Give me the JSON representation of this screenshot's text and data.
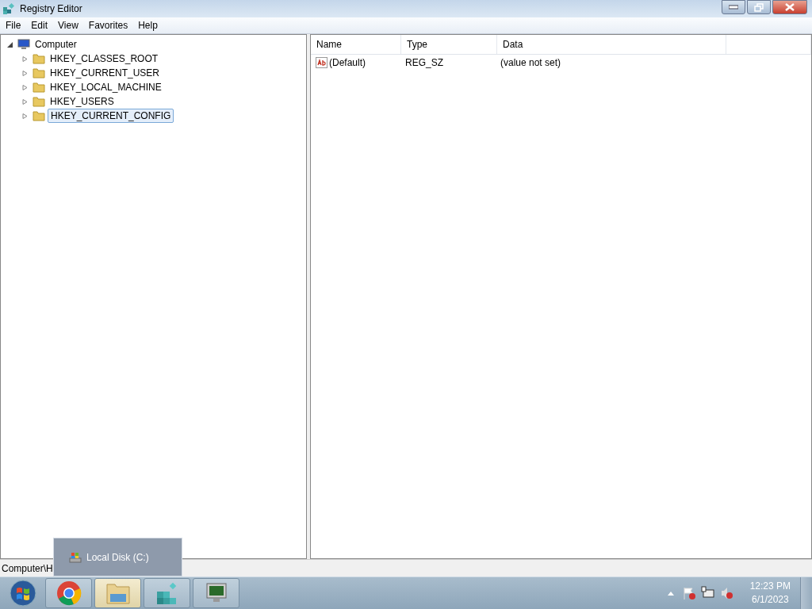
{
  "window": {
    "title": "Registry Editor"
  },
  "menu": [
    "File",
    "Edit",
    "View",
    "Favorites",
    "Help"
  ],
  "tree": {
    "label": "Computer",
    "expanded": true,
    "children": [
      {
        "label": "HKEY_CLASSES_ROOT",
        "expanded": false,
        "selected": false
      },
      {
        "label": "HKEY_CURRENT_USER",
        "expanded": false,
        "selected": false
      },
      {
        "label": "HKEY_LOCAL_MACHINE",
        "expanded": false,
        "selected": false
      },
      {
        "label": "HKEY_USERS",
        "expanded": false,
        "selected": false
      },
      {
        "label": "HKEY_CURRENT_CONFIG",
        "expanded": false,
        "selected": true
      }
    ]
  },
  "table": {
    "columns": [
      "Name",
      "Type",
      "Data"
    ],
    "rows": [
      {
        "name": "(Default)",
        "type": "REG_SZ",
        "data": "(value not set)"
      }
    ]
  },
  "status_bar": "Computer\\H",
  "popup": {
    "label": "Local Disk (C:)"
  },
  "taskbar": {
    "items": [
      {
        "kind": "chrome",
        "selected": false
      },
      {
        "kind": "folder",
        "selected": true
      },
      {
        "kind": "registry",
        "selected": false
      },
      {
        "kind": "monitor",
        "selected": false
      }
    ],
    "time": "12:23 PM",
    "date": "6/1/2023"
  }
}
